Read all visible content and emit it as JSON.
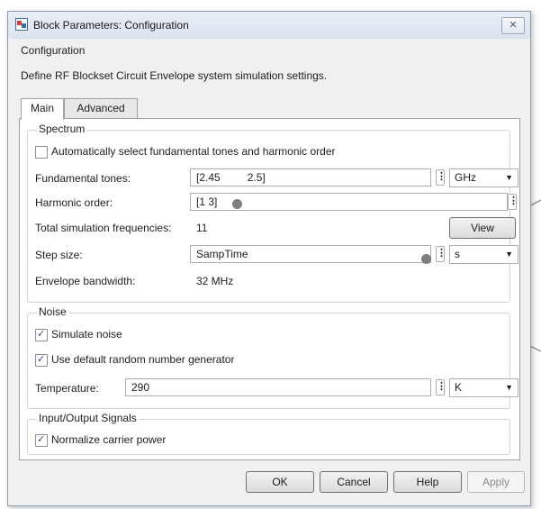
{
  "window": {
    "title": "Block Parameters: Configuration",
    "close_glyph": "✕"
  },
  "header": {
    "block_name": "Configuration",
    "description": "Define RF Blockset Circuit Envelope system simulation settings."
  },
  "tabs": [
    {
      "label": "Main",
      "active": true
    },
    {
      "label": "Advanced",
      "active": false
    }
  ],
  "spectrum": {
    "group_label": "Spectrum",
    "auto_select": {
      "label": "Automatically select fundamental tones and harmonic order",
      "checked": false
    },
    "fundamental_tones": {
      "label": "Fundamental tones:",
      "value": "[2.45         2.5]",
      "unit": "GHz"
    },
    "harmonic_order": {
      "label": "Harmonic order:",
      "value": "[1 3]"
    },
    "total_freqs": {
      "label": "Total simulation frequencies:",
      "value": "11",
      "button": "View"
    },
    "step_size": {
      "label": "Step size:",
      "value": "SampTime",
      "unit": "s"
    },
    "envelope_bw": {
      "label": "Envelope bandwidth:",
      "value": "32 MHz"
    }
  },
  "noise": {
    "group_label": "Noise",
    "simulate_noise": {
      "label": "Simulate noise",
      "checked": true
    },
    "default_rng": {
      "label": "Use default random number generator",
      "checked": true
    },
    "temperature": {
      "label": "Temperature:",
      "value": "290",
      "unit": "K"
    }
  },
  "io": {
    "group_label": "Input/Output Signals",
    "normalize_power": {
      "label": "Normalize carrier power",
      "checked": true
    }
  },
  "footer": {
    "ok": "OK",
    "cancel": "Cancel",
    "help": "Help",
    "apply": "Apply"
  },
  "dots_glyph": "⋮"
}
